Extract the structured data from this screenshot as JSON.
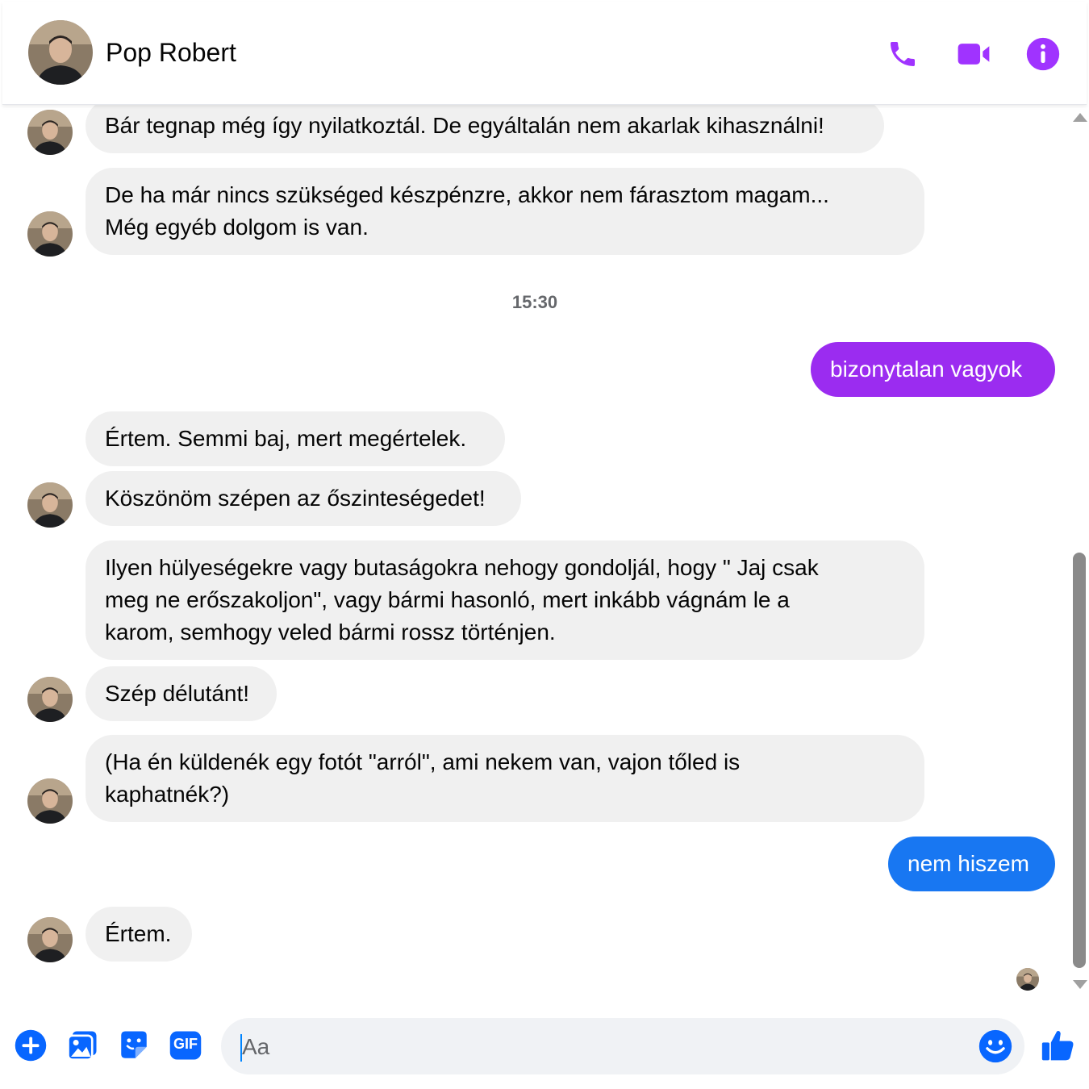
{
  "header": {
    "contact_name": "Pop Robert",
    "accent_color": "#a033ff",
    "icons": [
      "phone-icon",
      "video-camera-icon",
      "info-icon"
    ]
  },
  "messages": [
    {
      "from": "them",
      "text": "Bár tegnap még így nyilatkoztál. De egyáltalán nem akarlak kihasználni!"
    },
    {
      "from": "them",
      "text": "De ha már nincs szükséged készpénzre,  akkor nem fárasztom magam...\nMég egyéb dolgom is van."
    },
    {
      "from": "them",
      "text": "Értem. Semmi baj, mert megértelek."
    },
    {
      "from": "them",
      "text": "Köszönöm szépen az őszinteségedet!"
    },
    {
      "from": "them",
      "text": "Ilyen hülyeségekre vagy butaságokra nehogy gondoljál, hogy \" Jaj csak\nmeg ne erőszakoljon\", vagy bármi hasonló, mert inkább vágnám le a\nkarom, semhogy veled bármi rossz történjen."
    },
    {
      "from": "them",
      "text": "Szép délutánt!"
    },
    {
      "from": "them",
      "text": "(Ha én küldenék egy fotót \"arról\", ami nekem van,  vajon tőled is\nkaphatnék?)"
    },
    {
      "from": "them",
      "text": "Értem."
    }
  ],
  "sent": [
    {
      "text": "bizonytalan vagyok",
      "color": "#9b2cf0"
    },
    {
      "text": "nem hiszem",
      "color": "#1877f2"
    }
  ],
  "timestamp": "15:30",
  "composer": {
    "placeholder": "Aa",
    "icons": [
      "plus-icon",
      "image-icon",
      "sticker-icon",
      "gif-icon",
      "emoji-icon",
      "thumbs-up-icon"
    ],
    "gif_label": "GIF",
    "icon_color": "#0866ff"
  }
}
